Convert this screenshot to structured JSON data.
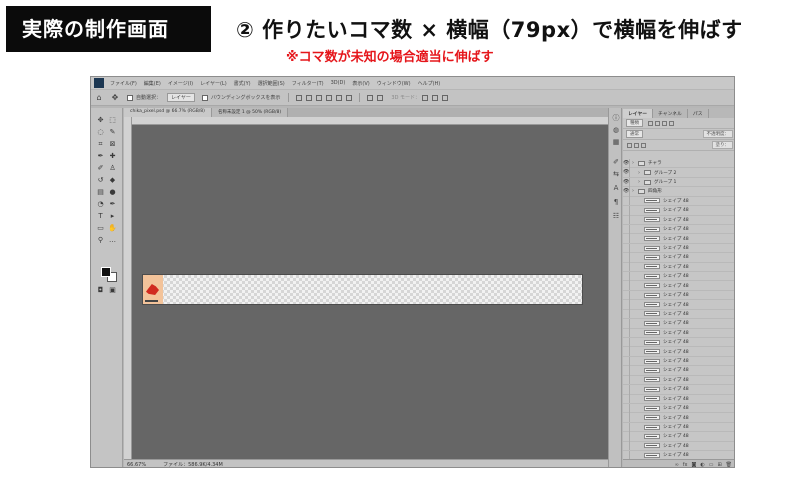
{
  "header": {
    "badge": "実際の制作画面",
    "title": "② 作りたいコマ数 × 横幅（79px）で横幅を伸ばす",
    "note": "※コマ数が未知の場合適当に伸ばす"
  },
  "app": {
    "menu": [
      "ファイル(F)",
      "編集(E)",
      "イメージ(I)",
      "レイヤー(L)",
      "書式(Y)",
      "選択範囲(S)",
      "フィルター(T)",
      "3D(D)",
      "表示(V)",
      "ウィンドウ(W)",
      "ヘルプ(H)"
    ],
    "options": {
      "auto_select_label": "自動選択：",
      "auto_select_target": "レイヤー",
      "transform_label": "バウンディングボックスを表示",
      "mode3d_label": "3D モード："
    },
    "doc_tabs": [
      "chika_pixel.psd @ 66.7% (RGB/8)",
      "名称未設定 1 @ 50% (RGB/8)"
    ],
    "status": {
      "zoom": "66.67%",
      "doc_info": "ファイル：586.9K/4.34M"
    }
  },
  "layers_panel": {
    "tabs": [
      "レイヤー",
      "チャンネル",
      "パス"
    ],
    "search_label": "種類",
    "blend_mode": "通常",
    "opacity_label": "不透明度：",
    "fill_label": "塗り：",
    "items": [
      {
        "name": "チャラ",
        "kind": "folder",
        "indent": 0,
        "visible": true
      },
      {
        "name": "グループ 2",
        "kind": "folder",
        "indent": 1,
        "visible": true
      },
      {
        "name": "グループ 1",
        "kind": "folder",
        "indent": 1,
        "visible": true
      },
      {
        "name": "四角形",
        "kind": "folder",
        "indent": 0,
        "visible": true
      },
      {
        "name": "シェイプ 48",
        "kind": "shape",
        "indent": 2,
        "visible": false
      },
      {
        "name": "シェイプ 48",
        "kind": "shape",
        "indent": 2,
        "visible": false
      },
      {
        "name": "シェイプ 48",
        "kind": "shape",
        "indent": 2,
        "visible": false
      },
      {
        "name": "シェイプ 48",
        "kind": "shape",
        "indent": 2,
        "visible": false
      },
      {
        "name": "シェイプ 48",
        "kind": "shape",
        "indent": 2,
        "visible": false
      },
      {
        "name": "シェイプ 48",
        "kind": "shape",
        "indent": 2,
        "visible": false
      },
      {
        "name": "シェイプ 48",
        "kind": "shape",
        "indent": 2,
        "visible": false
      },
      {
        "name": "シェイプ 48",
        "kind": "shape",
        "indent": 2,
        "visible": false
      },
      {
        "name": "シェイプ 48",
        "kind": "shape",
        "indent": 2,
        "visible": false
      },
      {
        "name": "シェイプ 48",
        "kind": "shape",
        "indent": 2,
        "visible": false
      },
      {
        "name": "シェイプ 48",
        "kind": "shape",
        "indent": 2,
        "visible": false
      },
      {
        "name": "シェイプ 48",
        "kind": "shape",
        "indent": 2,
        "visible": false
      },
      {
        "name": "シェイプ 48",
        "kind": "shape",
        "indent": 2,
        "visible": false
      },
      {
        "name": "シェイプ 48",
        "kind": "shape",
        "indent": 2,
        "visible": false
      },
      {
        "name": "シェイプ 48",
        "kind": "shape",
        "indent": 2,
        "visible": false
      },
      {
        "name": "シェイプ 48",
        "kind": "shape",
        "indent": 2,
        "visible": false
      },
      {
        "name": "シェイプ 48",
        "kind": "shape",
        "indent": 2,
        "visible": false
      },
      {
        "name": "シェイプ 48",
        "kind": "shape",
        "indent": 2,
        "visible": false
      },
      {
        "name": "シェイプ 48",
        "kind": "shape",
        "indent": 2,
        "visible": false
      },
      {
        "name": "シェイプ 48",
        "kind": "shape",
        "indent": 2,
        "visible": false
      },
      {
        "name": "シェイプ 48",
        "kind": "shape",
        "indent": 2,
        "visible": false
      },
      {
        "name": "シェイプ 48",
        "kind": "shape",
        "indent": 2,
        "visible": false
      },
      {
        "name": "シェイプ 48",
        "kind": "shape",
        "indent": 2,
        "visible": false
      },
      {
        "name": "シェイプ 48",
        "kind": "shape",
        "indent": 2,
        "visible": false
      },
      {
        "name": "シェイプ 48",
        "kind": "shape",
        "indent": 2,
        "visible": false
      },
      {
        "name": "シェイプ 48",
        "kind": "shape",
        "indent": 2,
        "visible": false
      },
      {
        "name": "シェイプ 48",
        "kind": "shape",
        "indent": 2,
        "visible": false
      },
      {
        "name": "シェイプ 48",
        "kind": "shape",
        "indent": 2,
        "visible": false
      },
      {
        "name": "背景",
        "kind": "background",
        "indent": 0,
        "visible": true
      }
    ]
  }
}
